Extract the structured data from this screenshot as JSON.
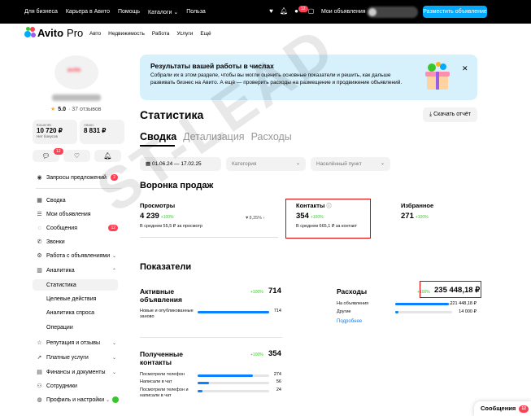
{
  "topbar": {
    "links": [
      "Для бизнеса",
      "Карьера в Авито",
      "Помощь",
      "Каталоги",
      "Польза"
    ],
    "notifications_badge": "12",
    "my_ads": "Мои объявления",
    "place_ad": "Разместить объявление",
    "icons": [
      "heart-icon",
      "bell-icon",
      "chat-icon",
      "cart-icon"
    ]
  },
  "header": {
    "logo": "Avito",
    "logo_suffix": "Pro",
    "nav": [
      "Авто",
      "Недвижимость",
      "Работа",
      "Услуги",
      "Ещё"
    ]
  },
  "profile": {
    "avatar_text": "avito",
    "rating": "5.0",
    "reviews": "· 37 отзывов",
    "wallet_label": "Кошелёк",
    "wallet_value": "10 720 ₽",
    "wallet_sub": "Нет бонусов",
    "advance_label": "Аванс",
    "advance_value": "8 831 ₽",
    "chat_badge": "12"
  },
  "sidebar": {
    "requests": "Запросы предложений",
    "requests_badge": "2",
    "items": [
      {
        "label": "Сводка",
        "icon": "grid-icon"
      },
      {
        "label": "Мои объявления",
        "icon": "list-icon"
      },
      {
        "label": "Сообщения",
        "icon": "message-icon",
        "badge": "12"
      },
      {
        "label": "Звонки",
        "icon": "phone-icon"
      },
      {
        "label": "Работа с объявлениями",
        "icon": "gear-icon",
        "chevron": "⌄"
      },
      {
        "label": "Аналитика",
        "icon": "chart-icon",
        "chevron": "⌃"
      }
    ],
    "analytics_sub": [
      "Статистика",
      "Целевые действия",
      "Аналитика спроса",
      "Операции"
    ],
    "bottom": [
      {
        "label": "Репутация и отзывы",
        "icon": "star-icon",
        "chevron": "⌄"
      },
      {
        "label": "Платные услуги",
        "icon": "rocket-icon",
        "chevron": "⌄"
      },
      {
        "label": "Финансы и документы",
        "icon": "wallet-icon",
        "chevron": "⌄"
      },
      {
        "label": "Сотрудники",
        "icon": "people-icon"
      },
      {
        "label": "Профиль и настройки",
        "icon": "user-icon",
        "chevron": "⌄"
      }
    ]
  },
  "banner": {
    "title": "Результаты вашей работы в числах",
    "body": "Собрали их в этом разделе, чтобы вы могли оценить основные показатели и решить, как дальше развивать бизнес на Авито. А ещё — проверить расходы на размещение и продвижение объявлений."
  },
  "page": {
    "title": "Статистика",
    "download": "Скачать отчёт",
    "tabs": [
      "Сводка",
      "Детализация",
      "Расходы"
    ],
    "filters": {
      "date": "01.06.24 — 17.02.25",
      "category": "Категория",
      "city": "Населённый пункт"
    }
  },
  "funnel": {
    "title": "Воронка продаж",
    "views": {
      "label": "Просмотры",
      "value": "4 239",
      "pct": "+100%",
      "sub": "В среднем 55,5 ₽ за просмотр"
    },
    "ratio": "8,35%",
    "contacts": {
      "label": "Контакты",
      "value": "354",
      "pct": "+100%",
      "sub": "В среднем 665,1 ₽ за контакт"
    },
    "favorites": {
      "label": "Избранное",
      "value": "271",
      "pct": "+100%"
    }
  },
  "indicators": {
    "title": "Показатели",
    "active": {
      "title_1": "Активные",
      "title_2": "объявления",
      "pct": "+100%",
      "value": "714",
      "rows": [
        {
          "label": "Новые и опубликованные заново",
          "value": "714",
          "fill": 1.0
        }
      ]
    },
    "expenses": {
      "title": "Расходы",
      "pct": "+100%",
      "value": "235 448,18 ₽",
      "rows": [
        {
          "label": "На объявления",
          "value": "221 448,18 ₽",
          "fill": 0.94
        },
        {
          "label": "Другие",
          "value": "14 000 ₽",
          "fill": 0.06
        }
      ],
      "more": "Подробнее"
    },
    "contacts": {
      "title_1": "Полученные",
      "title_2": "контакты",
      "pct": "+100%",
      "value": "354",
      "rows": [
        {
          "label": "Посмотрели телефон",
          "value": "274",
          "fill": 0.77
        },
        {
          "label": "Написали в чат",
          "value": "56",
          "fill": 0.16
        },
        {
          "label": "Посмотрели телефон и написали в чат",
          "value": "24",
          "fill": 0.07
        }
      ]
    }
  },
  "watermark": "ST-LEAD",
  "messages": {
    "label": "Сообщения",
    "badge": "12"
  },
  "colors": {
    "accent": "#00aaff",
    "positive": "#38c72b",
    "alert": "#ff4053",
    "bar": "#0a82ff",
    "highlight": "#e60000"
  }
}
